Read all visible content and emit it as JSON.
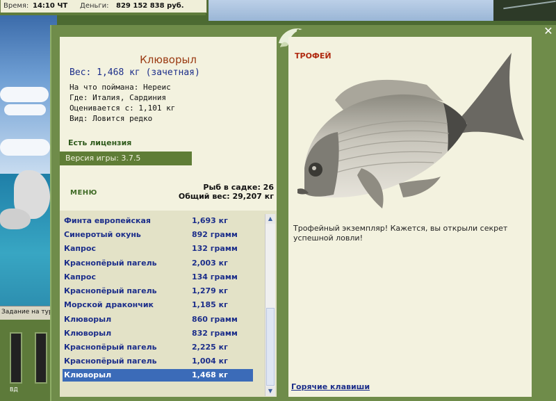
{
  "status_bar": {
    "time_label": "Время:",
    "time_value": "14:10 ЧТ",
    "money_label": "Деньги:",
    "money_value": "829 152 838 руб."
  },
  "background": {
    "task_label": "Задание на тур",
    "gauge_label": "ВД"
  },
  "window": {
    "close_symbol": "✕"
  },
  "fish_card": {
    "name": "Клюворыл",
    "weight": "Вес: 1,468 кг (зачетная)",
    "caught_with": "На что поймана: Нереис",
    "location": "Где: Италия, Сардиния",
    "rated_from": "Оценивается с: 1,101 кг",
    "species_note": "Вид: Ловится редко",
    "license": "Есть лицензия",
    "version": "Версия игры: 3.7.5"
  },
  "keepnet": {
    "menu_label": "МЕНЮ",
    "count": "Рыб в садке: 26",
    "total_weight": "Общий вес: 29,207 кг",
    "rows": [
      {
        "name": "Финта европейская",
        "weight": "1,693 кг"
      },
      {
        "name": "Синеротый окунь",
        "weight": "892 грамм"
      },
      {
        "name": "Капрос",
        "weight": "132 грамм"
      },
      {
        "name": "Краснопёрый пагель",
        "weight": "2,003 кг"
      },
      {
        "name": "Капрос",
        "weight": "134 грамм"
      },
      {
        "name": "Краснопёрый пагель",
        "weight": "1,279 кг"
      },
      {
        "name": "Морской дракончик",
        "weight": "1,185 кг"
      },
      {
        "name": "Клюворыл",
        "weight": "860 грамм"
      },
      {
        "name": "Клюворыл",
        "weight": "832 грамм"
      },
      {
        "name": "Краснопёрый пагель",
        "weight": "2,225 кг"
      },
      {
        "name": "Краснопёрый пагель",
        "weight": "1,004 кг"
      },
      {
        "name": "Клюворыл",
        "weight": "1,468 кг"
      }
    ],
    "selected_index": 11
  },
  "trophy_panel": {
    "badge": "ТРОФЕЙ",
    "description": "Трофейный экземпляр! Кажется, вы открыли секрет успешной ловли!",
    "hotkeys_link": "Горячие клавиши"
  },
  "colors": {
    "frame_green": "#6f8c4a",
    "panel_cream": "#f3f2df",
    "text_blue": "#1c2e8a",
    "selection_blue": "#3b6bb8",
    "fish_name_red": "#9a3a12"
  }
}
